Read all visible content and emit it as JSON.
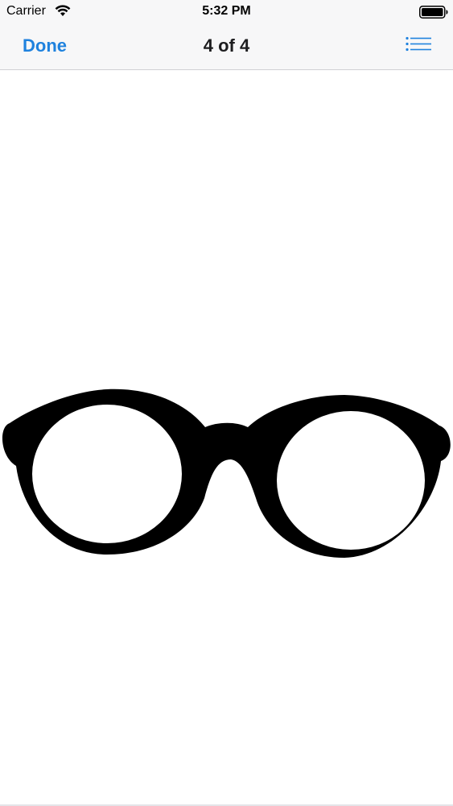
{
  "status_bar": {
    "carrier": "Carrier",
    "time": "5:32 PM",
    "wifi_icon": "wifi-icon",
    "battery_icon": "battery-full-icon"
  },
  "nav_bar": {
    "done_label": "Done",
    "title": "4 of 4",
    "list_icon": "list-icon"
  },
  "content": {
    "image_subject": "eyeglasses-icon"
  },
  "colors": {
    "accent": "#1f82de",
    "bar_background": "#f7f7f8",
    "image_fill": "#000000"
  }
}
